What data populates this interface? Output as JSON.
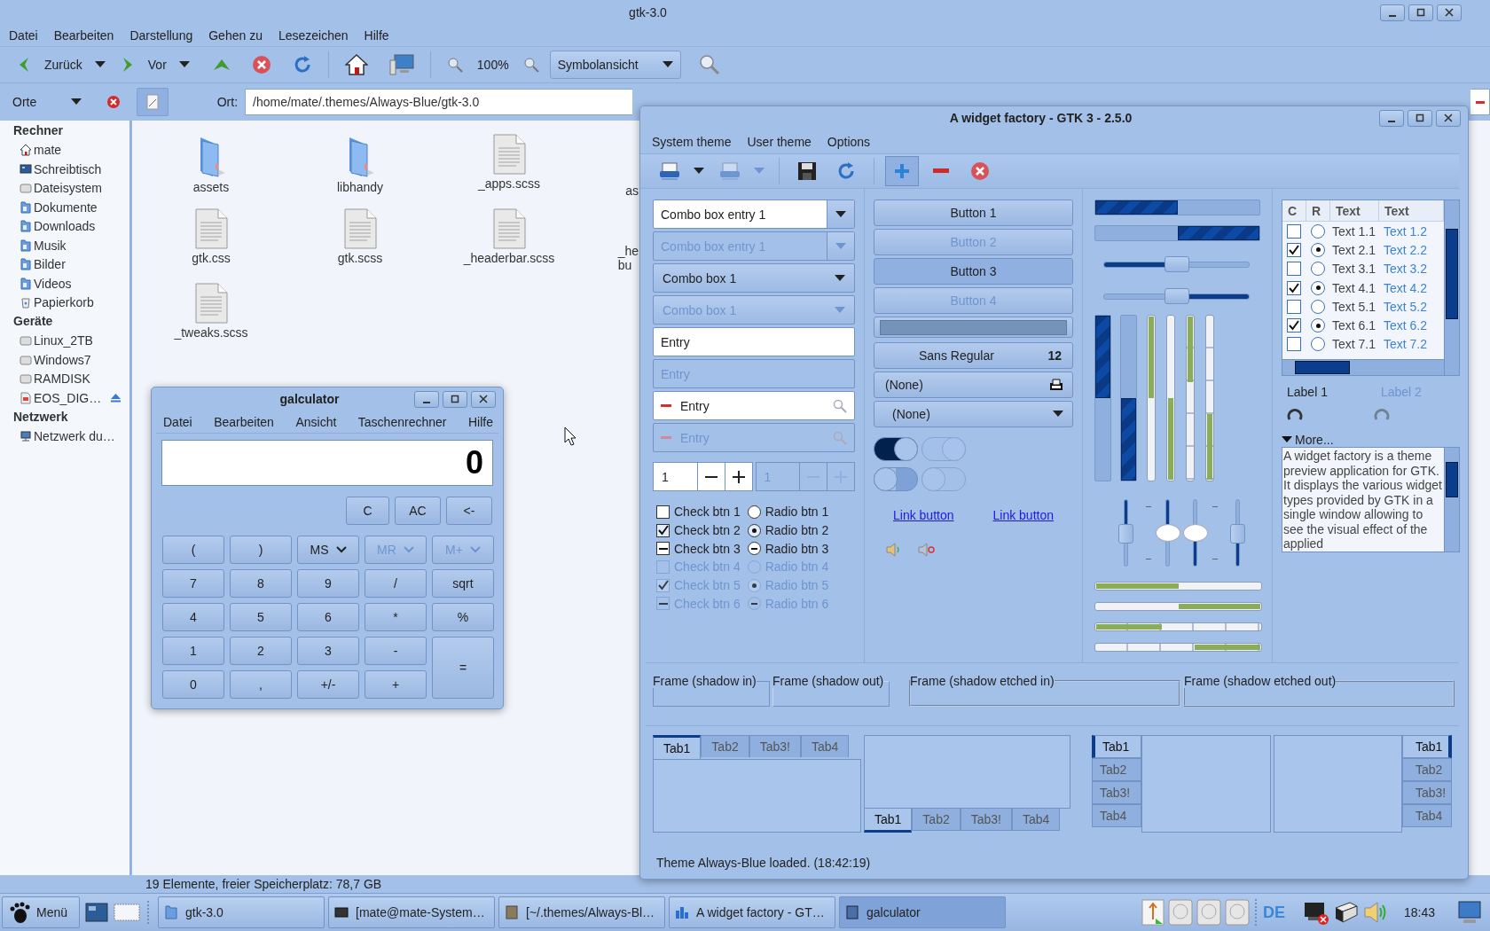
{
  "file_manager": {
    "title": "gtk-3.0",
    "menu": [
      "Datei",
      "Bearbeiten",
      "Darstellung",
      "Gehen zu",
      "Lesezeichen",
      "Hilfe"
    ],
    "back": "Zurück",
    "forward": "Vor",
    "zoom": "100%",
    "view": "Symbolansicht",
    "places_selector": "Orte",
    "location_label": "Ort:",
    "location": "/home/mate/.themes/Always-Blue/gtk-3.0",
    "sidebar": [
      {
        "heading": "Rechner",
        "items": [
          {
            "label": "mate",
            "kind": "home"
          },
          {
            "label": "Schreibtisch",
            "kind": "desktop"
          },
          {
            "label": "Dateisystem",
            "kind": "drive"
          },
          {
            "label": "Dokumente",
            "kind": "folder"
          },
          {
            "label": "Downloads",
            "kind": "folder"
          },
          {
            "label": "Musik",
            "kind": "folder"
          },
          {
            "label": "Bilder",
            "kind": "folder"
          },
          {
            "label": "Videos",
            "kind": "folder"
          },
          {
            "label": "Papierkorb",
            "kind": "trash"
          }
        ]
      },
      {
        "heading": "Geräte",
        "items": [
          {
            "label": "Linux_2TB",
            "kind": "drive"
          },
          {
            "label": "Windows7",
            "kind": "drive"
          },
          {
            "label": "RAMDISK",
            "kind": "drive"
          },
          {
            "label": "EOS_DIG…",
            "kind": "removable"
          }
        ]
      },
      {
        "heading": "Netzwerk",
        "items": [
          {
            "label": "Netzwerk du…",
            "kind": "network"
          }
        ]
      }
    ],
    "files": [
      {
        "name": "assets",
        "kind": "folder"
      },
      {
        "name": "libhandy",
        "kind": "folder"
      },
      {
        "name": "_apps.scss",
        "kind": "file"
      },
      {
        "name": "as",
        "kind": "cut"
      },
      {
        "name": "gtk.css",
        "kind": "file"
      },
      {
        "name": "gtk.scss",
        "kind": "file"
      },
      {
        "name": "_headerbar.scss",
        "kind": "file"
      },
      {
        "name": "_he bu",
        "kind": "cut"
      },
      {
        "name": "_tweaks.scss",
        "kind": "file"
      }
    ],
    "status_bar": "19 Elemente, freier Speicherplatz: 78,7 GB"
  },
  "calculator": {
    "title": "galculator",
    "menu": [
      "Datei",
      "Bearbeiten",
      "Ansicht",
      "Taschenrechner",
      "Hilfe"
    ],
    "display": "0",
    "top_keys": [
      {
        "label": "C"
      },
      {
        "label": "AC"
      },
      {
        "label": "<-"
      }
    ],
    "keys": [
      {
        "label": "(",
        "kind": "key",
        "disabled": false
      },
      {
        "label": ")",
        "kind": "key",
        "disabled": false
      },
      {
        "label": "MS",
        "kind": "menu",
        "disabled": false
      },
      {
        "label": "MR",
        "kind": "menu",
        "disabled": true
      },
      {
        "label": "M+",
        "kind": "menu",
        "disabled": true
      },
      {
        "label": "7",
        "kind": "key",
        "disabled": false
      },
      {
        "label": "8",
        "kind": "key",
        "disabled": false
      },
      {
        "label": "9",
        "kind": "key",
        "disabled": false
      },
      {
        "label": "/",
        "kind": "key",
        "disabled": false
      },
      {
        "label": "sqrt",
        "kind": "key",
        "disabled": false
      },
      {
        "label": "4",
        "kind": "key",
        "disabled": false
      },
      {
        "label": "5",
        "kind": "key",
        "disabled": false
      },
      {
        "label": "6",
        "kind": "key",
        "disabled": false
      },
      {
        "label": "*",
        "kind": "key",
        "disabled": false
      },
      {
        "label": "%",
        "kind": "key",
        "disabled": false
      },
      {
        "label": "1",
        "kind": "key",
        "disabled": false
      },
      {
        "label": "2",
        "kind": "key",
        "disabled": false
      },
      {
        "label": "3",
        "kind": "key",
        "disabled": false
      },
      {
        "label": "-",
        "kind": "key",
        "disabled": false
      },
      {
        "label": "=",
        "kind": "tall",
        "disabled": false
      },
      {
        "label": "0",
        "kind": "key",
        "disabled": false
      },
      {
        "label": ",",
        "kind": "key",
        "disabled": false
      },
      {
        "label": "+/-",
        "kind": "key",
        "disabled": false
      },
      {
        "label": "+",
        "kind": "key",
        "disabled": false
      }
    ]
  },
  "widget_factory": {
    "title": "A widget factory - GTK 3 - 2.5.0",
    "menu": [
      "System theme",
      "User theme",
      "Options"
    ],
    "toolbar": [
      [
        {
          "kind": "printer",
          "disabled": false,
          "pressed": false
        },
        {
          "kind": "printer",
          "disabled": true,
          "pressed": false
        }
      ],
      [
        {
          "kind": "save",
          "disabled": false,
          "pressed": false
        },
        {
          "kind": "reload",
          "disabled": false,
          "pressed": false
        }
      ],
      [
        {
          "kind": "add",
          "disabled": false,
          "pressed": true
        },
        {
          "kind": "remove",
          "disabled": false,
          "pressed": false
        },
        {
          "kind": "stop",
          "disabled": false,
          "pressed": false
        }
      ]
    ],
    "combos": [
      {
        "kind": "entry",
        "text": "Combo box entry 1",
        "disabled": false
      },
      {
        "kind": "entry",
        "text": "Combo box entry 1",
        "disabled": true
      },
      {
        "kind": "plain",
        "text": "Combo box 1",
        "disabled": false
      },
      {
        "kind": "plain",
        "text": "Combo box 1",
        "disabled": true
      }
    ],
    "entries": [
      {
        "kind": "plain",
        "text": "Entry",
        "disabled": false
      },
      {
        "kind": "plain",
        "text": "Entry",
        "disabled": true
      },
      {
        "kind": "icons",
        "text": "Entry",
        "disabled": false
      },
      {
        "kind": "icons",
        "text": "Entry",
        "disabled": true
      }
    ],
    "spins": [
      {
        "value": "1",
        "disabled": false
      },
      {
        "value": "1",
        "disabled": true
      }
    ],
    "checks": [
      {
        "label": "Check btn 1",
        "checked": false,
        "inconsistent": false,
        "disabled": false
      },
      {
        "label": "Check btn 2",
        "checked": true,
        "inconsistent": false,
        "disabled": false
      },
      {
        "label": "Check btn 3",
        "checked": false,
        "inconsistent": true,
        "disabled": false
      },
      {
        "label": "Check btn 4",
        "checked": false,
        "inconsistent": false,
        "disabled": true
      },
      {
        "label": "Check btn 5",
        "checked": true,
        "inconsistent": false,
        "disabled": true
      },
      {
        "label": "Check btn 6",
        "checked": false,
        "inconsistent": true,
        "disabled": true
      }
    ],
    "radios": [
      {
        "label": "Radio btn 1",
        "selected": false,
        "inconsistent": false,
        "disabled": false
      },
      {
        "label": "Radio btn 2",
        "selected": true,
        "inconsistent": false,
        "disabled": false
      },
      {
        "label": "Radio btn 3",
        "selected": false,
        "inconsistent": true,
        "disabled": false
      },
      {
        "label": "Radio btn 4",
        "selected": false,
        "inconsistent": false,
        "disabled": true
      },
      {
        "label": "Radio btn 5",
        "selected": true,
        "inconsistent": false,
        "disabled": true
      },
      {
        "label": "Radio btn 6",
        "selected": false,
        "inconsistent": true,
        "disabled": true
      }
    ],
    "buttons": [
      {
        "label": "Button 1",
        "pressed": false,
        "disabled": false
      },
      {
        "label": "Button 2",
        "pressed": false,
        "disabled": true
      },
      {
        "label": "Button 3",
        "pressed": true,
        "disabled": false
      },
      {
        "label": "Button 4",
        "pressed": false,
        "disabled": true
      }
    ],
    "font_button": {
      "name": "Sans Regular",
      "size": "12"
    },
    "file_button": "(None)",
    "combo_button": "(None)",
    "switches": [
      {
        "on": true,
        "disabled": false
      },
      {
        "on": true,
        "disabled": true
      },
      {
        "on": false,
        "disabled": false
      },
      {
        "on": false,
        "disabled": true
      }
    ],
    "links": [
      "Link button",
      "Link button"
    ],
    "volume_buttons": [
      {
        "muted": false
      },
      {
        "muted": true
      }
    ],
    "progress_h": [
      {
        "level": 0.5,
        "inverted": false
      },
      {
        "level": 0.5,
        "inverted": true
      }
    ],
    "sliders_h": [
      {
        "level": 0.5,
        "inverted": false
      },
      {
        "level": 0.5,
        "inverted": true
      }
    ],
    "progress_v": [
      {
        "level": 0.5,
        "inverted": false
      },
      {
        "level": 0.5,
        "inverted": true
      }
    ],
    "level_v": [
      {
        "level": 0.5,
        "inverted": false,
        "discrete": false
      },
      {
        "level": 0.5,
        "inverted": true,
        "discrete": false
      },
      {
        "level": 0.4,
        "inverted": false,
        "discrete": true
      },
      {
        "level": 0.4,
        "inverted": true,
        "discrete": true
      }
    ],
    "scales_v": [
      {
        "level": 0.5,
        "inverted": false,
        "marks": false
      },
      {
        "level": 0.5,
        "inverted": false,
        "marks": true
      },
      {
        "level": 0.5,
        "inverted": true,
        "marks": true
      },
      {
        "level": 0.5,
        "inverted": true,
        "marks": false
      }
    ],
    "level_h": [
      {
        "level": 0.5,
        "inverted": false,
        "discrete": false
      },
      {
        "level": 0.5,
        "inverted": true,
        "discrete": false
      },
      {
        "level": 0.4,
        "inverted": false,
        "discrete": true
      },
      {
        "level": 0.4,
        "inverted": true,
        "discrete": true
      }
    ],
    "table": {
      "columns": [
        "C",
        "R",
        "Text",
        "Text"
      ],
      "rows": [
        {
          "checked": false,
          "selected": false,
          "text_1": "Text 1.1",
          "text_2": "Text 1.2"
        },
        {
          "checked": true,
          "selected": true,
          "text_1": "Text 2.1",
          "text_2": "Text 2.2"
        },
        {
          "checked": false,
          "selected": false,
          "text_1": "Text 3.1",
          "text_2": "Text 3.2"
        },
        {
          "checked": true,
          "selected": true,
          "text_1": "Text 4.1",
          "text_2": "Text 4.2"
        },
        {
          "checked": false,
          "selected": false,
          "text_1": "Text 5.1",
          "text_2": "Text 5.2"
        },
        {
          "checked": true,
          "selected": true,
          "text_1": "Text 6.1",
          "text_2": "Text 6.2"
        },
        {
          "checked": false,
          "selected": false,
          "text_1": "Text 7.1",
          "text_2": "Text 7.2"
        }
      ]
    },
    "labels": [
      {
        "text": "Label 1",
        "disabled": false
      },
      {
        "text": "Label 2",
        "disabled": true
      }
    ],
    "spinners": [
      {
        "disabled": false
      },
      {
        "disabled": true
      }
    ],
    "expander": {
      "label": "More...",
      "expanded": true,
      "text": "A widget factory is a theme preview application for GTK. It displays the various widget types provided by GTK in a single window allowing to see the visual effect of the applied"
    },
    "frames": [
      {
        "label": "Frame (shadow in)",
        "kind": "in"
      },
      {
        "label": "Frame (shadow out)",
        "kind": "out"
      },
      {
        "label": "Frame (shadow etched in)",
        "kind": "etched_in"
      },
      {
        "label": "Frame (shadow etched out)",
        "kind": "etched_out"
      }
    ],
    "notebooks": [
      {
        "kind": "top",
        "tabs": [
          {
            "label": "Tab1",
            "selected": true
          },
          {
            "label": "Tab2",
            "selected": false
          },
          {
            "label": "Tab3!",
            "selected": false
          },
          {
            "label": "Tab4",
            "selected": false
          }
        ]
      },
      {
        "kind": "bottom",
        "tabs": [
          {
            "label": "Tab1",
            "selected": true
          },
          {
            "label": "Tab2",
            "selected": false
          },
          {
            "label": "Tab3!",
            "selected": false
          },
          {
            "label": "Tab4",
            "selected": false
          }
        ]
      },
      {
        "kind": "left",
        "tabs": [
          {
            "label": "Tab1",
            "selected": true
          },
          {
            "label": "Tab2",
            "selected": false
          },
          {
            "label": "Tab3!",
            "selected": false
          },
          {
            "label": "Tab4",
            "selected": false
          }
        ]
      },
      {
        "kind": "right",
        "tabs": [
          {
            "label": "Tab1",
            "selected": true
          },
          {
            "label": "Tab2",
            "selected": false
          },
          {
            "label": "Tab3!",
            "selected": false
          },
          {
            "label": "Tab4",
            "selected": false
          }
        ]
      }
    ],
    "status": "Theme Always-Blue loaded.  (18:42:19)"
  },
  "taskbar": {
    "menu_button": "Menü",
    "tasks": [
      {
        "label": "gtk-3.0",
        "kind": "folder",
        "selected": false
      },
      {
        "label": "[mate@mate-System…",
        "kind": "terminal",
        "selected": false
      },
      {
        "label": "[~/.themes/Always-Bl…",
        "kind": "editor",
        "selected": false
      },
      {
        "label": "A widget factory - GT…",
        "kind": "app",
        "selected": false
      },
      {
        "label": "galculator",
        "kind": "calc",
        "selected": true
      }
    ],
    "keyboard_layout": "DE",
    "clock": "18:43"
  }
}
